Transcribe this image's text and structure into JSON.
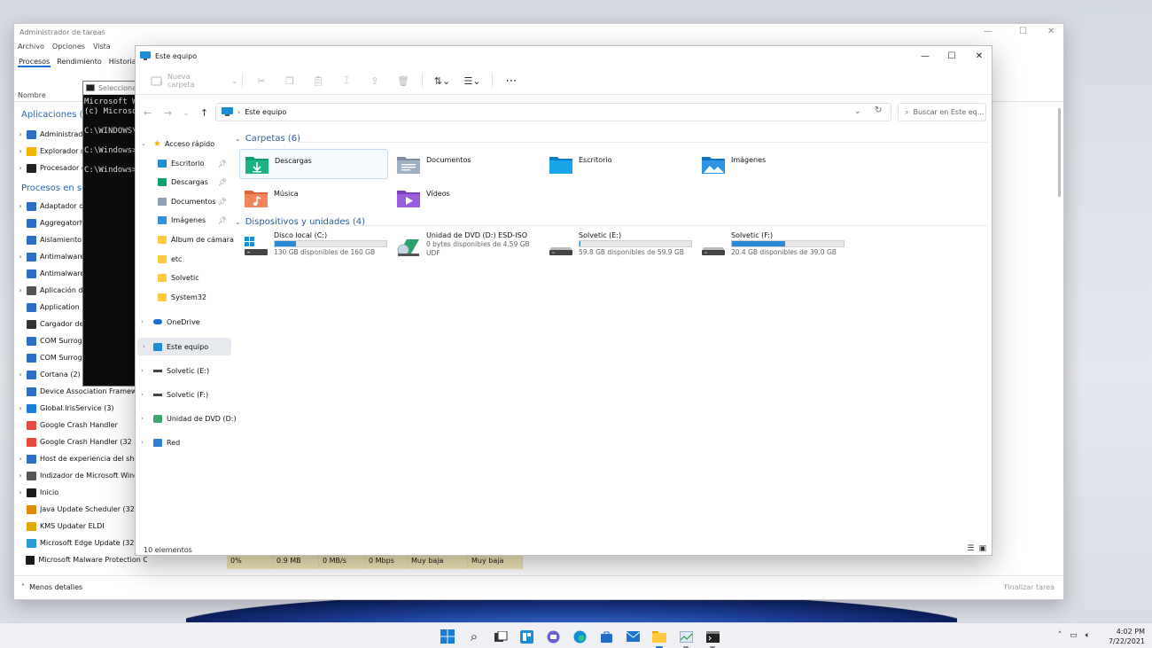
{
  "task_manager": {
    "title": "Administrador de tareas",
    "menu": [
      "Archivo",
      "Opciones",
      "Vista"
    ],
    "tabs": [
      "Procesos",
      "Rendimiento",
      "Historial d"
    ],
    "column_name": "Nombre",
    "sections": {
      "apps": "Aplicaciones (3",
      "background": "Procesos en se"
    },
    "apps": [
      "Administrad",
      "Explorador d",
      "Procesador d"
    ],
    "processes": [
      "Adaptador d",
      "Aggregatorh",
      "Aislamiento",
      "Antimalware",
      "Antimalware",
      "Aplicación d",
      "Application",
      "Cargador de",
      "COM Surrog",
      "COM Surrog",
      "Cortana (2)",
      "Device Association Framewo",
      "Global.IrisService (3)",
      "Google Crash Handler",
      "Google Crash Handler (32 bi",
      "Host de experiencia del shell",
      "Indizador de Microsoft Wind",
      "Inicio",
      "Java Update Scheduler (32 bi",
      "KMS Updater ELDI",
      "Microsoft Edge Update (32 b",
      "Microsoft Malware Protection C..."
    ],
    "stats": [
      "0%",
      "0.9 MB",
      "0 MB/s",
      "0 Mbps",
      "Muy baja",
      "Muy baja"
    ],
    "fewer_details": "Menos detalles",
    "end_task": "Finalizar tarea"
  },
  "cmd": {
    "title": "Selecciona",
    "lines": [
      "Microsoft W",
      "(c) Microso",
      "",
      "C:\\WINDOWS\\",
      "",
      "C:\\Windows>",
      "",
      "C:\\Windows>"
    ]
  },
  "explorer": {
    "title": "Este equipo",
    "new_folder": "Nueva carpeta",
    "address": "Este equipo",
    "search_placeholder": "Buscar en Este eq...",
    "nav": {
      "quick_access": "Acceso rápido",
      "quick_items": [
        "Escritorio",
        "Descargas",
        "Documentos",
        "Imágenes",
        "Álbum de cámara",
        "etc",
        "Solvetic",
        "System32"
      ],
      "onedrive": "OneDrive",
      "this_pc": "Este equipo",
      "solvetic_e": "Solvetic (E:)",
      "solvetic_f": "Solvetic (F:)",
      "dvd": "Unidad de DVD (D:)",
      "network": "Red"
    },
    "folders_header": "Carpetas (6)",
    "folders": [
      "Descargas",
      "Documentos",
      "Escritorio",
      "Imágenes",
      "Música",
      "Vídeos"
    ],
    "drives_header": "Dispositivos y unidades (4)",
    "drives": [
      {
        "name": "Disco local (C:)",
        "free": "130 GB disponibles de 160 GB",
        "used": 0.19
      },
      {
        "name": "Unidad de DVD (D:) ESD-ISO",
        "free": "0 bytes disponibles de 4.59 GB",
        "extra": "UDF"
      },
      {
        "name": "Solvetic (E:)",
        "free": "59.8 GB disponibles de 59.9 GB",
        "used": 0.002
      },
      {
        "name": "Solvetic (F:)",
        "free": "20.4 GB disponibles de 39.0 GB",
        "used": 0.48
      }
    ],
    "status": "10 elementos"
  },
  "taskbar": {
    "clock_time": "4:02 PM",
    "clock_date": "7/22/2021"
  }
}
